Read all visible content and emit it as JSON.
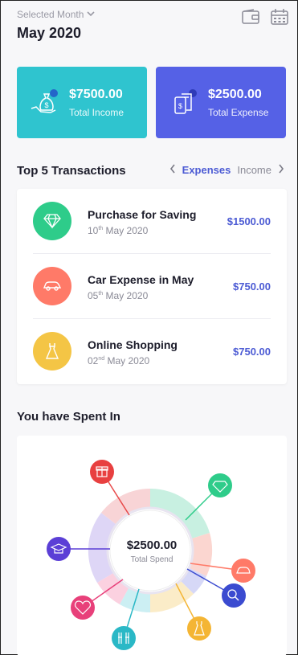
{
  "header": {
    "selected_month_label": "Selected Month",
    "month_title": "May 2020"
  },
  "summary": {
    "income_amount": "$7500.00",
    "income_label": "Total Income",
    "expense_amount": "$2500.00",
    "expense_label": "Total Expense"
  },
  "transactions_section": {
    "title": "Top 5 Transactions",
    "tab_active": "Expenses",
    "tab_inactive": "Income"
  },
  "transactions": [
    {
      "name": "Purchase for Saving",
      "day": "10",
      "suffix": "th",
      "rest": " May 2020",
      "amount": "$1500.00",
      "color": "#2ecc8a",
      "icon": "diamond-icon"
    },
    {
      "name": "Car Expense in May",
      "day": "05",
      "suffix": "th",
      "rest": " May 2020",
      "amount": "$750.00",
      "color": "#ff7a68",
      "icon": "car-icon"
    },
    {
      "name": "Online Shopping",
      "day": "02",
      "suffix": "nd",
      "rest": " May 2020",
      "amount": "$750.00",
      "color": "#f4c545",
      "icon": "dress-icon"
    }
  ],
  "spent_section": {
    "title": "You have Spent In",
    "center_amount": "$2500.00",
    "center_label": "Total Spend"
  },
  "colors": {
    "income_card": "#2fc4cf",
    "expense_card": "#5561e6",
    "accent": "#4c5bd4"
  }
}
